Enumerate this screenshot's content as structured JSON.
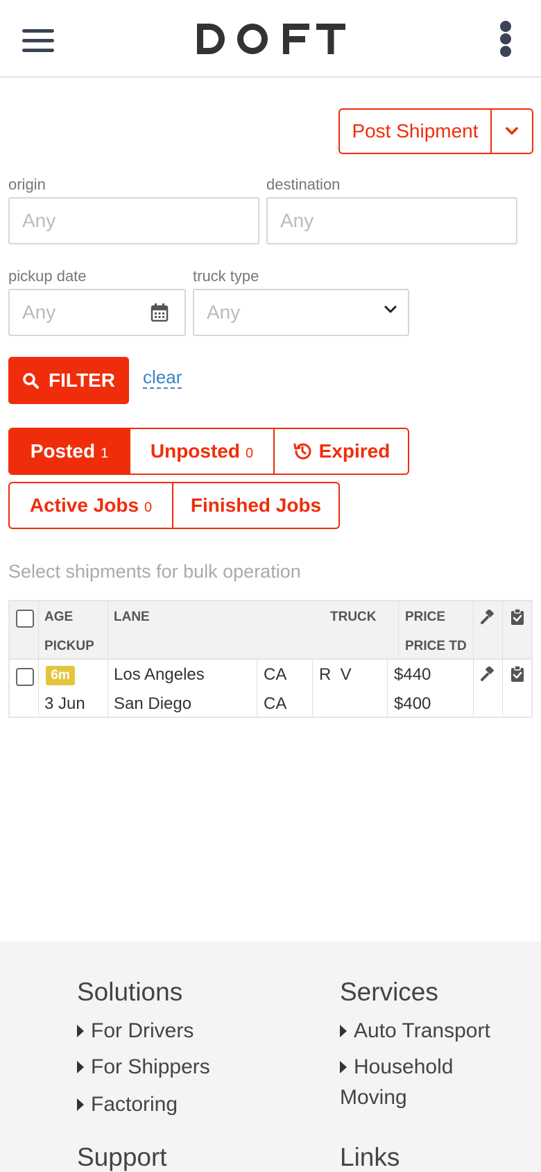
{
  "brand": "DOFT",
  "colors": {
    "accent": "#f02d0a",
    "link": "#3a86c8",
    "badge": "#e3c53b",
    "nav_icon": "#3b4455"
  },
  "header": {
    "menu_icon": "hamburger-menu-icon",
    "more_icon": "kebab-menu-icon"
  },
  "actions": {
    "post_shipment": "Post Shipment",
    "post_dropdown_icon": "chevron-down-icon"
  },
  "filters": {
    "origin_label": "origin",
    "origin_placeholder": "Any",
    "destination_label": "destination",
    "destination_placeholder": "Any",
    "pickup_date_label": "pickup date",
    "pickup_date_placeholder": "Any",
    "truck_type_label": "truck type",
    "truck_type_value": "Any",
    "filter_button": "FILTER",
    "clear_link": "clear"
  },
  "tabs": {
    "posted": {
      "label": "Posted",
      "count": "1"
    },
    "unposted": {
      "label": "Unposted",
      "count": "0"
    },
    "expired": {
      "label": "Expired",
      "icon": "history-icon"
    },
    "active_jobs": {
      "label": "Active Jobs",
      "count": "0"
    },
    "finished_jobs": {
      "label": "Finished Jobs"
    }
  },
  "bulk_text": "Select shipments for bulk operation",
  "table": {
    "headers": {
      "age": "AGE",
      "pickup": "PICKUP",
      "lane": "LANE",
      "truck": "TRUCK",
      "price": "PRICE",
      "price_td": "PRICE TD"
    },
    "rows": [
      {
        "age": "6m",
        "pickup": "3 Jun",
        "origin_city": "Los Angeles",
        "origin_state": "CA",
        "dest_city": "San Diego",
        "dest_state": "CA",
        "truck": "R  V",
        "price": "$440",
        "price_td": "$400"
      }
    ]
  },
  "footer": {
    "solutions_title": "Solutions",
    "solutions": [
      "For Drivers",
      "For Shippers",
      "Factoring"
    ],
    "services_title": "Services",
    "services": [
      "Auto Transport",
      "Household",
      "Moving"
    ],
    "support_title": "Support",
    "links_title": "Links"
  }
}
